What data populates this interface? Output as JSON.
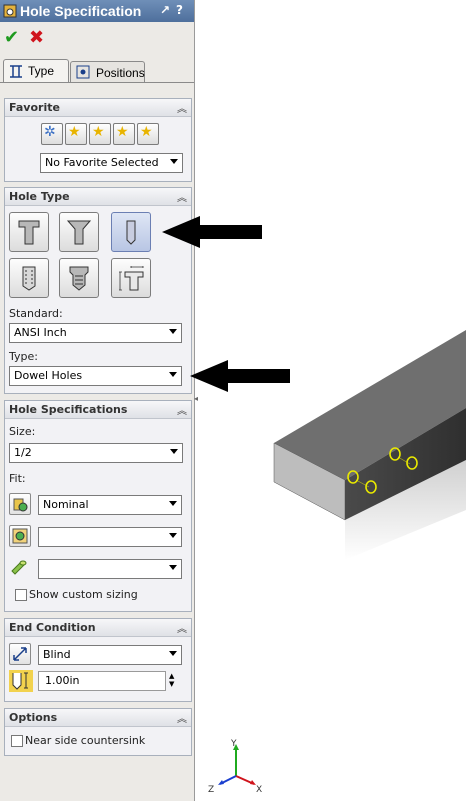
{
  "window": {
    "title": "Hole Specification",
    "help": "?",
    "pin": "↗"
  },
  "tabs": [
    {
      "label": "Type"
    },
    {
      "label": "Positions"
    }
  ],
  "favorite": {
    "title": "Favorite",
    "selected": "No Favorite Selected"
  },
  "hole_type": {
    "title": "Hole Type",
    "standard_label": "Standard:",
    "standard": "ANSI Inch",
    "type_label": "Type:",
    "type": "Dowel Holes"
  },
  "hole_specs": {
    "title": "Hole Specifications",
    "size_label": "Size:",
    "size": "1/2",
    "fit_label": "Fit:",
    "fit": "Nominal",
    "field2": "",
    "field3": "",
    "custom_sizing": "Show custom sizing"
  },
  "end_condition": {
    "title": "End Condition",
    "value": "Blind",
    "depth": "1.00in"
  },
  "options": {
    "title": "Options",
    "near_side": "Near side countersink"
  },
  "triad": {
    "x": "X",
    "y": "Y",
    "z": "Z"
  },
  "colors": {
    "titlebar": "#4e6f9c",
    "ok": "#1e9a1e",
    "cancel": "#d0141c",
    "model_top": "#6f6f6f",
    "hole_outline": "#e8e800"
  }
}
